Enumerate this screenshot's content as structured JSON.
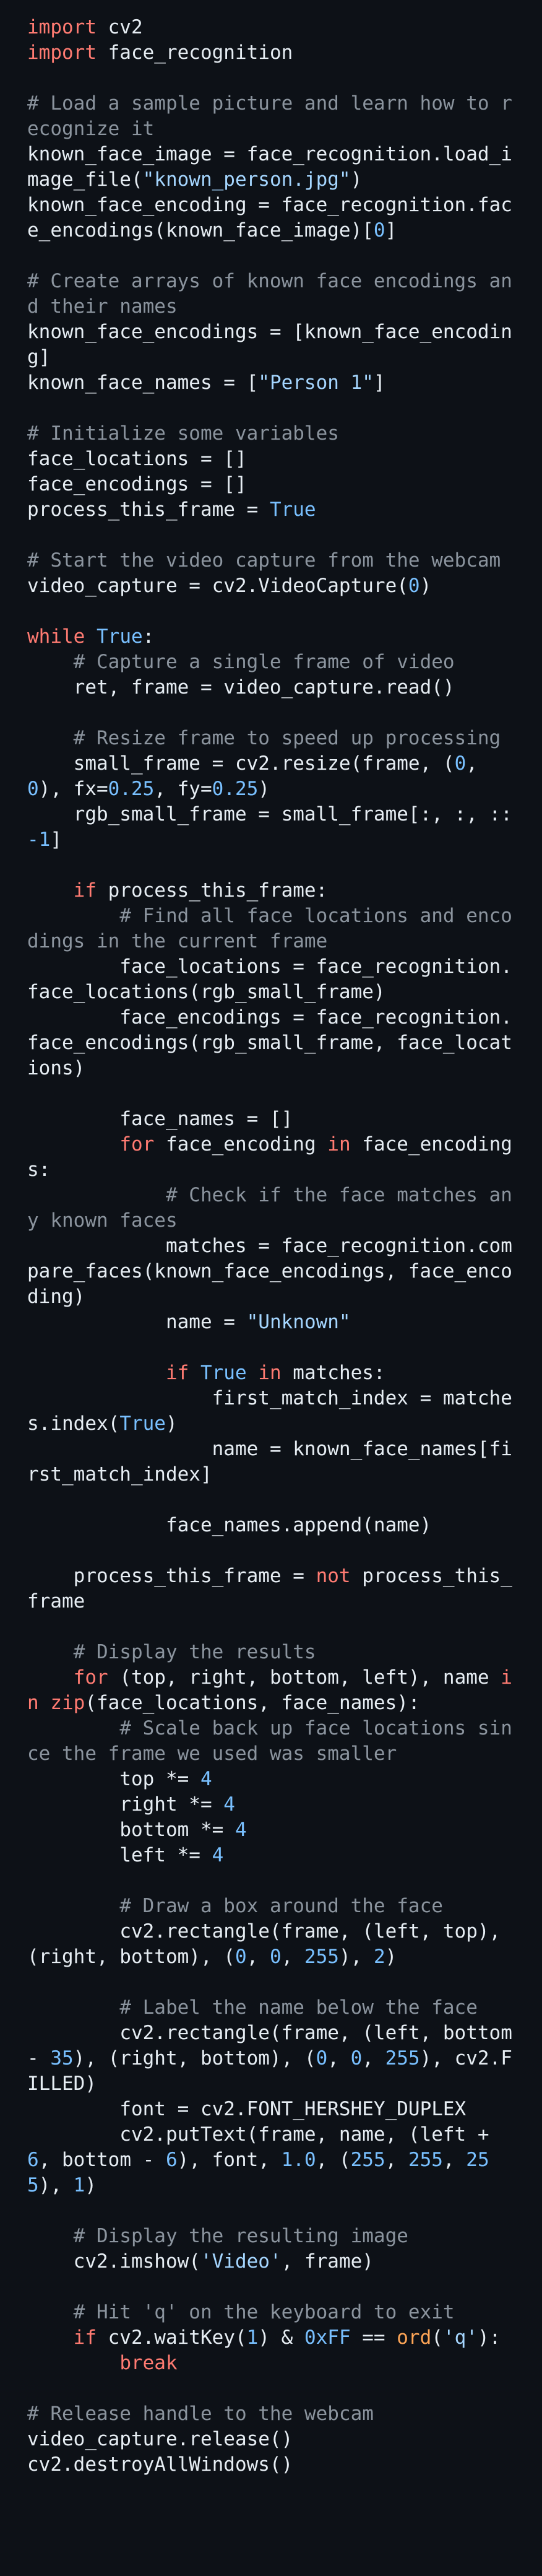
{
  "editor": {
    "language": "python",
    "colors": {
      "background": "#0d1117",
      "text": "#e6edf3",
      "keyword": "#ff7b72",
      "string": "#a5d6ff",
      "number": "#79c0ff",
      "comment": "#8b949e",
      "builtin": "#ffa657"
    },
    "lines": [
      [
        [
          "kw",
          "import"
        ],
        [
          "t",
          " cv2"
        ]
      ],
      [
        [
          "kw",
          "import"
        ],
        [
          "t",
          " face_recognition"
        ]
      ],
      [],
      [
        [
          "cmt",
          "# Load a sample picture and learn how to recognize it"
        ]
      ],
      [
        [
          "t",
          "known_face_image = face_recognition.load_image_file("
        ],
        [
          "str",
          "\"known_person.jpg\""
        ],
        [
          "t",
          ")"
        ]
      ],
      [
        [
          "t",
          "known_face_encoding = face_recognition.face_encodings(known_face_image)["
        ],
        [
          "num",
          "0"
        ],
        [
          "t",
          "]"
        ]
      ],
      [],
      [
        [
          "cmt",
          "# Create arrays of known face encodings and their names"
        ]
      ],
      [
        [
          "t",
          "known_face_encodings = [known_face_encoding]"
        ]
      ],
      [
        [
          "t",
          "known_face_names = ["
        ],
        [
          "str",
          "\"Person 1\""
        ],
        [
          "t",
          "]"
        ]
      ],
      [],
      [
        [
          "cmt",
          "# Initialize some variables"
        ]
      ],
      [
        [
          "t",
          "face_locations = []"
        ]
      ],
      [
        [
          "t",
          "face_encodings = []"
        ]
      ],
      [
        [
          "t",
          "process_this_frame = "
        ],
        [
          "num",
          "True"
        ]
      ],
      [],
      [
        [
          "cmt",
          "# Start the video capture from the webcam"
        ]
      ],
      [
        [
          "t",
          "video_capture = cv2.VideoCapture("
        ],
        [
          "num",
          "0"
        ],
        [
          "t",
          ")"
        ]
      ],
      [],
      [
        [
          "kw",
          "while"
        ],
        [
          "t",
          " "
        ],
        [
          "num",
          "True"
        ],
        [
          "t",
          ":"
        ]
      ],
      [
        [
          "t",
          "    "
        ],
        [
          "cmt",
          "# Capture a single frame of video"
        ]
      ],
      [
        [
          "t",
          "    ret, frame = video_capture.read()"
        ]
      ],
      [],
      [
        [
          "t",
          "    "
        ],
        [
          "cmt",
          "# Resize frame to speed up processing"
        ]
      ],
      [
        [
          "t",
          "    small_frame = cv2.resize(frame, ("
        ],
        [
          "num",
          "0"
        ],
        [
          "t",
          ", "
        ],
        [
          "num",
          "0"
        ],
        [
          "t",
          "), fx="
        ],
        [
          "num",
          "0.25"
        ],
        [
          "t",
          ", fy="
        ],
        [
          "num",
          "0.25"
        ],
        [
          "t",
          ")"
        ]
      ],
      [
        [
          "t",
          "    rgb_small_frame = small_frame[:, :, ::"
        ],
        [
          "num",
          "-1"
        ],
        [
          "t",
          "]"
        ]
      ],
      [],
      [
        [
          "t",
          "    "
        ],
        [
          "kw",
          "if"
        ],
        [
          "t",
          " process_this_frame:"
        ]
      ],
      [
        [
          "t",
          "        "
        ],
        [
          "cmt",
          "# Find all face locations and encodings in the current frame"
        ]
      ],
      [
        [
          "t",
          "        face_locations = face_recognition.face_locations(rgb_small_frame)"
        ]
      ],
      [
        [
          "t",
          "        face_encodings = face_recognition.face_encodings(rgb_small_frame, face_locations)"
        ]
      ],
      [],
      [
        [
          "t",
          "        face_names = []"
        ]
      ],
      [
        [
          "t",
          "        "
        ],
        [
          "kw",
          "for"
        ],
        [
          "t",
          " face_encoding "
        ],
        [
          "kw",
          "in"
        ],
        [
          "t",
          " face_encodings:"
        ]
      ],
      [
        [
          "t",
          "            "
        ],
        [
          "cmt",
          "# Check if the face matches any known faces"
        ]
      ],
      [
        [
          "t",
          "            matches = face_recognition.compare_faces(known_face_encodings, face_encoding)"
        ]
      ],
      [
        [
          "t",
          "            name = "
        ],
        [
          "str",
          "\"Unknown\""
        ]
      ],
      [],
      [
        [
          "t",
          "            "
        ],
        [
          "kw",
          "if"
        ],
        [
          "t",
          " "
        ],
        [
          "num",
          "True"
        ],
        [
          "t",
          " "
        ],
        [
          "kw",
          "in"
        ],
        [
          "t",
          " matches:"
        ]
      ],
      [
        [
          "t",
          "                first_match_index = matches.index("
        ],
        [
          "num",
          "True"
        ],
        [
          "t",
          ")"
        ]
      ],
      [
        [
          "t",
          "                name = known_face_names[first_match_index]"
        ]
      ],
      [],
      [
        [
          "t",
          "            face_names.append(name)"
        ]
      ],
      [],
      [
        [
          "t",
          "    process_this_frame = "
        ],
        [
          "kw",
          "not"
        ],
        [
          "t",
          " process_this_frame"
        ]
      ],
      [],
      [
        [
          "t",
          "    "
        ],
        [
          "cmt",
          "# Display the results"
        ]
      ],
      [
        [
          "t",
          "    "
        ],
        [
          "kw",
          "for"
        ],
        [
          "t",
          " (top, right, bottom, left), name "
        ],
        [
          "kw",
          "in"
        ],
        [
          "t",
          " "
        ],
        [
          "kw",
          "zip"
        ],
        [
          "t",
          "(face_locations, face_names):"
        ]
      ],
      [
        [
          "t",
          "        "
        ],
        [
          "cmt",
          "# Scale back up face locations since the frame we used was smaller"
        ]
      ],
      [
        [
          "t",
          "        top *= "
        ],
        [
          "num",
          "4"
        ]
      ],
      [
        [
          "t",
          "        right *= "
        ],
        [
          "num",
          "4"
        ]
      ],
      [
        [
          "t",
          "        bottom *= "
        ],
        [
          "num",
          "4"
        ]
      ],
      [
        [
          "t",
          "        left *= "
        ],
        [
          "num",
          "4"
        ]
      ],
      [],
      [
        [
          "t",
          "        "
        ],
        [
          "cmt",
          "# Draw a box around the face"
        ]
      ],
      [
        [
          "t",
          "        cv2.rectangle(frame, (left, top), (right, bottom), ("
        ],
        [
          "num",
          "0"
        ],
        [
          "t",
          ", "
        ],
        [
          "num",
          "0"
        ],
        [
          "t",
          ", "
        ],
        [
          "num",
          "255"
        ],
        [
          "t",
          "), "
        ],
        [
          "num",
          "2"
        ],
        [
          "t",
          ")"
        ]
      ],
      [],
      [
        [
          "t",
          "        "
        ],
        [
          "cmt",
          "# Label the name below the face"
        ]
      ],
      [
        [
          "t",
          "        cv2.rectangle(frame, (left, bottom - "
        ],
        [
          "num",
          "35"
        ],
        [
          "t",
          "), (right, bottom), ("
        ],
        [
          "num",
          "0"
        ],
        [
          "t",
          ", "
        ],
        [
          "num",
          "0"
        ],
        [
          "t",
          ", "
        ],
        [
          "num",
          "255"
        ],
        [
          "t",
          "), cv2.FILLED)"
        ]
      ],
      [
        [
          "t",
          "        font = cv2.FONT_HERSHEY_DUPLEX"
        ]
      ],
      [
        [
          "t",
          "        cv2.putText(frame, name, (left + "
        ],
        [
          "num",
          "6"
        ],
        [
          "t",
          ", bottom - "
        ],
        [
          "num",
          "6"
        ],
        [
          "t",
          "), font, "
        ],
        [
          "num",
          "1.0"
        ],
        [
          "t",
          ", ("
        ],
        [
          "num",
          "255"
        ],
        [
          "t",
          ", "
        ],
        [
          "num",
          "255"
        ],
        [
          "t",
          ", "
        ],
        [
          "num",
          "255"
        ],
        [
          "t",
          "), "
        ],
        [
          "num",
          "1"
        ],
        [
          "t",
          ")"
        ]
      ],
      [],
      [
        [
          "t",
          "    "
        ],
        [
          "cmt",
          "# Display the resulting image"
        ]
      ],
      [
        [
          "t",
          "    cv2.imshow("
        ],
        [
          "str",
          "'Video'"
        ],
        [
          "t",
          ", frame)"
        ]
      ],
      [],
      [
        [
          "t",
          "    "
        ],
        [
          "cmt",
          "# Hit 'q' on the keyboard to exit"
        ]
      ],
      [
        [
          "t",
          "    "
        ],
        [
          "kw",
          "if"
        ],
        [
          "t",
          " cv2.waitKey("
        ],
        [
          "num",
          "1"
        ],
        [
          "t",
          ") & "
        ],
        [
          "num",
          "0xFF"
        ],
        [
          "t",
          " == "
        ],
        [
          "bi",
          "ord"
        ],
        [
          "t",
          "("
        ],
        [
          "str",
          "'q'"
        ],
        [
          "t",
          "):"
        ]
      ],
      [
        [
          "t",
          "        "
        ],
        [
          "kw",
          "break"
        ]
      ],
      [],
      [
        [
          "cmt",
          "# Release handle to the webcam"
        ]
      ],
      [
        [
          "t",
          "video_capture.release()"
        ]
      ],
      [
        [
          "t",
          "cv2.destroyAllWindows()"
        ]
      ]
    ]
  }
}
